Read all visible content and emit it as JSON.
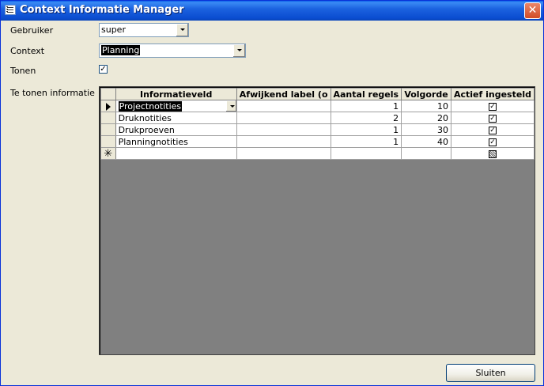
{
  "window": {
    "title": "Context Informatie Manager",
    "close_glyph": "✕"
  },
  "form": {
    "gebruiker_label": "Gebruiker",
    "gebruiker_value": "super",
    "context_label": "Context",
    "context_value": "Planning",
    "tonen_label": "Tonen",
    "tonen_checked": true,
    "te_tonen_label": "Te tonen informatie"
  },
  "grid": {
    "columns": [
      "Informatieveld",
      "Afwijkend label (o",
      "Aantal regels",
      "Volgorde",
      "Actief ingesteld"
    ],
    "rows": [
      {
        "informatieveld": "Projectnotities",
        "afwijkend": "",
        "aantal": "1",
        "volgorde": "10",
        "actief": true
      },
      {
        "informatieveld": "Druknotities",
        "afwijkend": "",
        "aantal": "2",
        "volgorde": "20",
        "actief": true
      },
      {
        "informatieveld": "Drukproeven",
        "afwijkend": "",
        "aantal": "1",
        "volgorde": "30",
        "actief": true
      },
      {
        "informatieveld": "Planningnotities",
        "afwijkend": "",
        "aantal": "1",
        "volgorde": "40",
        "actief": true
      }
    ],
    "current_marker": "▶",
    "new_marker": "✳",
    "check_glyph": "✓"
  },
  "buttons": {
    "sluiten_accel": "S",
    "sluiten_rest": "luiten"
  },
  "colors": {
    "titlebar": "#0a4cd0",
    "dialog_bg": "#ece9d8",
    "subform_bg": "#808080"
  }
}
